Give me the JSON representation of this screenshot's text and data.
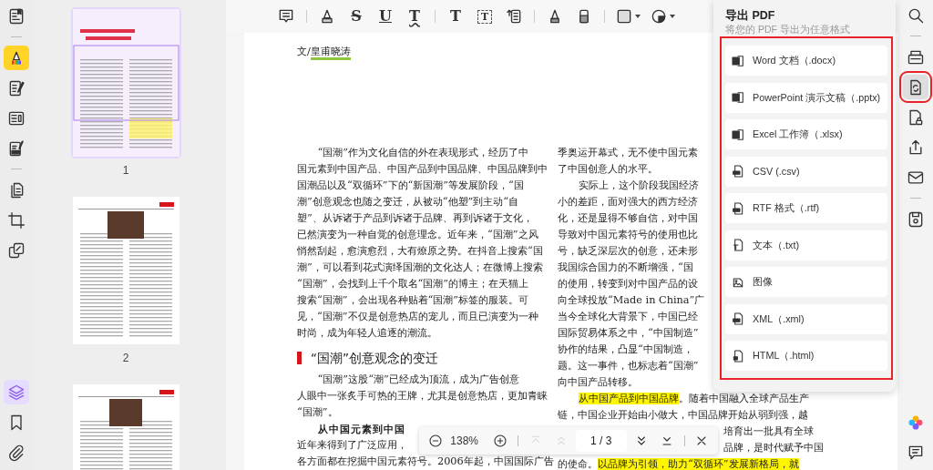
{
  "left_rail": {
    "top": [
      {
        "kind": "reader",
        "selected": false
      },
      {
        "kind": "divider"
      },
      {
        "kind": "highlighter",
        "selected": true
      },
      {
        "kind": "edit",
        "selected": false
      },
      {
        "kind": "form",
        "selected": false
      },
      {
        "kind": "sign",
        "selected": false
      },
      {
        "kind": "divider"
      },
      {
        "kind": "pages",
        "selected": false
      },
      {
        "kind": "crop",
        "selected": false
      },
      {
        "kind": "compare",
        "selected": false
      }
    ],
    "bottom": [
      {
        "kind": "layers",
        "selected": true
      },
      {
        "kind": "bookmark",
        "selected": false
      },
      {
        "kind": "attachment",
        "selected": false
      }
    ]
  },
  "thumbnails": [
    {
      "kind": "cover",
      "label": "1",
      "selected": true
    },
    {
      "kind": "photo",
      "label": "2",
      "selected": false
    },
    {
      "kind": "photo-left",
      "selected": false
    }
  ],
  "toolbar": [
    {
      "kind": "note"
    },
    {
      "kind": "divider"
    },
    {
      "kind": "highlight"
    },
    {
      "kind": "strikethrough",
      "glyph": "S"
    },
    {
      "kind": "underline",
      "glyph": "U"
    },
    {
      "kind": "squiggly",
      "glyph": "T"
    },
    {
      "kind": "divider"
    },
    {
      "kind": "text",
      "glyph": "T"
    },
    {
      "kind": "textbox",
      "glyph": "T"
    },
    {
      "kind": "callout"
    },
    {
      "kind": "divider"
    },
    {
      "kind": "pencil"
    },
    {
      "kind": "eraser"
    },
    {
      "kind": "divider"
    },
    {
      "kind": "shape",
      "dropdown": true
    },
    {
      "kind": "stamp",
      "dropdown": true
    }
  ],
  "document": {
    "byline": {
      "segments": [
        {
          "text": "文/"
        },
        {
          "text": "皇甫晓涛",
          "underlined": true
        }
      ]
    },
    "left_column": [
      {
        "kind": "line",
        "indent": true,
        "text": "“国潮”作为文化自信的外在表现形式，经历了中"
      },
      {
        "kind": "line",
        "text": "国元素到中国产品、中国产品到中国品牌、中国品牌到中"
      },
      {
        "kind": "line",
        "text": "国潮品以及“双循环”下的“新国潮”等发展阶段，“国"
      },
      {
        "kind": "line",
        "text": "潮”创意观念也随之变迁，从被动“他塑”到主动“自"
      },
      {
        "kind": "line",
        "text": "塑”、从诉诸于产品到诉诸于品牌、再到诉诸于文化，"
      },
      {
        "kind": "line",
        "text": "已然演变为一种自觉的创意理念。近年来，“国潮”之风"
      },
      {
        "kind": "line",
        "text": "悄然刮起，愈演愈烈，大有燎原之势。在抖音上搜索“国"
      },
      {
        "kind": "line",
        "text": "潮”，可以看到花式演绎国潮的文化达人；在微博上搜索"
      },
      {
        "kind": "line",
        "text": "“国潮”，会找到上千个取名“国潮”的博主；在天猫上"
      },
      {
        "kind": "line",
        "text": "搜索“国潮”，会出现各种贴着“国潮”标签的服装。可"
      },
      {
        "kind": "line",
        "text": "见，“国潮”不仅是创意热店的宠儿，而且已演变为一种"
      },
      {
        "kind": "line",
        "text": "时尚，成为年轻人追逐的潮流。"
      },
      {
        "kind": "heading",
        "text": "“国潮”创意观念的变迁"
      },
      {
        "kind": "line",
        "indent": true,
        "text": "“国潮”这股“潮”已经成为顶流，成为广告创意"
      },
      {
        "kind": "line",
        "text": "人眼中一张炙手可热的王牌，尤其是创意热店，更加青睐"
      },
      {
        "kind": "line",
        "text": "“国潮”。"
      },
      {
        "kind": "line",
        "indent": true,
        "bold": true,
        "text": "从中国元素到中国"
      },
      {
        "kind": "line",
        "text": "近年来得到了广泛应用，"
      },
      {
        "kind": "line",
        "text": "各方面都在挖掘中国元素符号。2006年起，中国国际广告"
      }
    ],
    "right_column": [
      {
        "kind": "line",
        "text": "季奥运开幕式，无不使中国元素"
      },
      {
        "kind": "line",
        "text": "了中国创意人的水平。"
      },
      {
        "kind": "line",
        "indent": true,
        "text": "实际上，这个阶段我国经济"
      },
      {
        "kind": "line",
        "text": "小的差距，面对强大的西方经济"
      },
      {
        "kind": "line",
        "text": "化，还是显得不够自信，对中国"
      },
      {
        "kind": "line",
        "text": "导致对中国元素符号的使用也比"
      },
      {
        "kind": "line",
        "text": "号，缺乏深层次的创意，还未形"
      },
      {
        "kind": "line",
        "text": "我国综合国力的不断增强，“国"
      },
      {
        "kind": "line",
        "text": "的使用，转变到对中国产品的设"
      },
      {
        "kind": "line",
        "text": "向全球投放“Made in China”广"
      },
      {
        "kind": "line",
        "text": "当今全球化大背景下，中国已经"
      },
      {
        "kind": "line",
        "text": "国际贸易体系之中，“中国制造”"
      },
      {
        "kind": "line",
        "text": "协作的结果，凸显“中国制造，"
      },
      {
        "kind": "line",
        "text": "题。这一事件，也标志着“国潮”"
      },
      {
        "kind": "line",
        "text": "向中国产品转移。"
      },
      {
        "kind": "line",
        "indent": true,
        "segments": [
          {
            "text": "从中国产品到中国品牌",
            "highlighted": true
          },
          {
            "text": "。随着中国融入全球产品生产"
          }
        ]
      },
      {
        "kind": "line",
        "text": "链，中国企业开始由小做大，中国品牌开始从弱到强，越"
      },
      {
        "kind": "tail",
        "text": "培育出一批具有全球"
      },
      {
        "kind": "tail",
        "text": "品牌，是时代赋予中国"
      },
      {
        "kind": "line",
        "segments": [
          {
            "text": "的使命。"
          },
          {
            "text": "以品牌为引领，助力“双循环”发展新格局，就",
            "highlighted": true
          }
        ]
      }
    ]
  },
  "export_panel": {
    "title": "导出 PDF",
    "subtitle": "将您的 PDF 导出为任意格式",
    "framed": true,
    "items": [
      {
        "kind": "word",
        "label": "Word 文档（.docx)"
      },
      {
        "kind": "ppt",
        "label": "PowerPoint 演示文稿（.pptx)"
      },
      {
        "kind": "excel",
        "label": "Excel 工作簿（.xlsx)"
      },
      {
        "kind": "csv",
        "label": "CSV (.csv)"
      },
      {
        "kind": "rtf",
        "label": "RTF 格式（.rtf)"
      },
      {
        "kind": "txt",
        "label": "文本（.txt)"
      },
      {
        "kind": "image",
        "label": "图像"
      },
      {
        "kind": "xml",
        "label": "XML（.xml)"
      },
      {
        "kind": "html",
        "label": "HTML（.html)"
      }
    ]
  },
  "right_rail": {
    "top": [
      {
        "kind": "search",
        "selected": false
      },
      {
        "kind": "divider"
      },
      {
        "kind": "ocr",
        "selected": false
      },
      {
        "kind": "export",
        "selected": true,
        "framed": true
      },
      {
        "kind": "protect",
        "selected": false
      },
      {
        "kind": "share",
        "selected": false
      },
      {
        "kind": "mail",
        "selected": false
      },
      {
        "kind": "divider"
      },
      {
        "kind": "save",
        "selected": false
      }
    ],
    "bottom": [
      {
        "kind": "app",
        "selected": false
      },
      {
        "kind": "comment",
        "selected": false
      }
    ]
  },
  "bottom_bar": [
    {
      "kind": "zoom-out"
    },
    {
      "kind": "zoom",
      "value": "138%"
    },
    {
      "kind": "zoom-in"
    },
    {
      "kind": "divider"
    },
    {
      "kind": "first",
      "disabled": true
    },
    {
      "kind": "prev",
      "disabled": true
    },
    {
      "kind": "page",
      "value": "1 / 3"
    },
    {
      "kind": "next",
      "disabled": false
    },
    {
      "kind": "last",
      "disabled": false
    },
    {
      "kind": "divider"
    },
    {
      "kind": "close"
    }
  ]
}
